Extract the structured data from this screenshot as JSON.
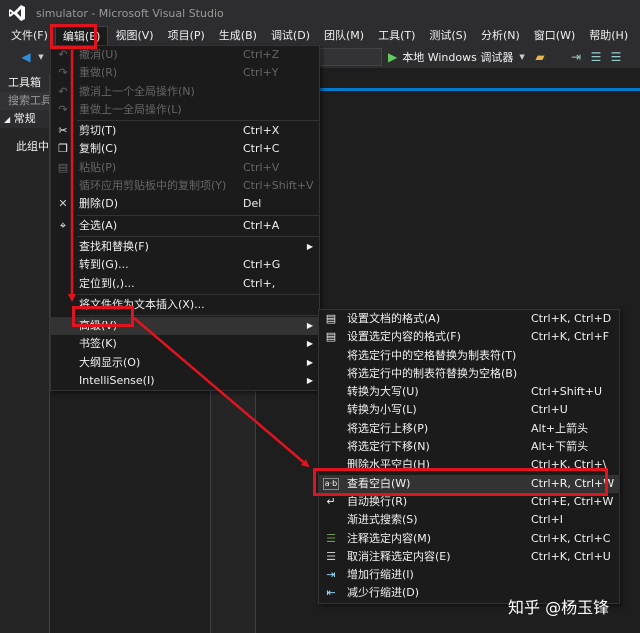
{
  "window": {
    "title": "simulator - Microsoft Visual Studio"
  },
  "menubar": {
    "items": [
      "文件(F)",
      "编辑(E)",
      "视图(V)",
      "项目(P)",
      "生成(B)",
      "调试(D)",
      "团队(M)",
      "工具(T)",
      "测试(S)",
      "分析(N)",
      "窗口(W)",
      "帮助(H)"
    ]
  },
  "toolbar": {
    "run_label": "本地 Windows 调试器"
  },
  "toolbox": {
    "title": "工具箱",
    "search_placeholder": "搜索工具",
    "group": "常规",
    "empty_note": "此组中没有可用的控件"
  },
  "edit_menu": {
    "items": [
      {
        "label": "撤消(U)",
        "shortcut": "Ctrl+Z",
        "disabled": true,
        "icon": "undo-icon"
      },
      {
        "label": "重做(R)",
        "shortcut": "Ctrl+Y",
        "disabled": true,
        "icon": "redo-icon"
      },
      {
        "label": "撤消上一个全局操作(N)",
        "shortcut": "",
        "disabled": true,
        "icon": "undo-global-icon"
      },
      {
        "label": "重做上一全局操作(L)",
        "shortcut": "",
        "disabled": true,
        "icon": "redo-global-icon"
      },
      {
        "sep": true
      },
      {
        "label": "剪切(T)",
        "shortcut": "Ctrl+X",
        "icon": "cut-icon"
      },
      {
        "label": "复制(C)",
        "shortcut": "Ctrl+C",
        "icon": "copy-icon"
      },
      {
        "label": "粘贴(P)",
        "shortcut": "Ctrl+V",
        "disabled": true,
        "icon": "paste-icon"
      },
      {
        "label": "循环应用剪贴板中的复制项(Y)",
        "shortcut": "Ctrl+Shift+V",
        "disabled": true
      },
      {
        "label": "删除(D)",
        "shortcut": "Del",
        "icon": "delete-icon"
      },
      {
        "sep": true
      },
      {
        "label": "全选(A)",
        "shortcut": "Ctrl+A",
        "icon": "select-all-icon"
      },
      {
        "sep": true
      },
      {
        "label": "查找和替换(F)",
        "shortcut": "",
        "submenu": true
      },
      {
        "label": "转到(G)...",
        "shortcut": "Ctrl+G"
      },
      {
        "label": "定位到(,)...",
        "shortcut": "Ctrl+,"
      },
      {
        "sep": true
      },
      {
        "label": "将文件作为文本插入(X)...",
        "shortcut": ""
      },
      {
        "sep": true
      },
      {
        "label": "高级(V)",
        "shortcut": "",
        "submenu": true,
        "highlighted": true
      },
      {
        "label": "书签(K)",
        "shortcut": "",
        "submenu": true
      },
      {
        "label": "大纲显示(O)",
        "shortcut": "",
        "submenu": true
      },
      {
        "label": "IntelliSense(I)",
        "shortcut": "",
        "submenu": true
      }
    ]
  },
  "advanced_menu": {
    "items": [
      {
        "label": "设置文档的格式(A)",
        "shortcut": "Ctrl+K, Ctrl+D",
        "icon": "format-document-icon"
      },
      {
        "label": "设置选定内容的格式(F)",
        "shortcut": "Ctrl+K, Ctrl+F",
        "icon": "format-selection-icon"
      },
      {
        "label": "将选定行中的空格替换为制表符(T)",
        "shortcut": ""
      },
      {
        "label": "将选定行中的制表符替换为空格(B)",
        "shortcut": ""
      },
      {
        "label": "转换为大写(U)",
        "shortcut": "Ctrl+Shift+U"
      },
      {
        "label": "转换为小写(L)",
        "shortcut": "Ctrl+U"
      },
      {
        "label": "将选定行上移(P)",
        "shortcut": "Alt+上箭头"
      },
      {
        "label": "将选定行下移(N)",
        "shortcut": "Alt+下箭头"
      },
      {
        "label": "删除水平空白(H)",
        "shortcut": "Ctrl+K, Ctrl+\\"
      },
      {
        "label": "查看空白(W)",
        "shortcut": "Ctrl+R, Ctrl+W",
        "icon": "view-whitespace-icon",
        "highlighted": true
      },
      {
        "label": "自动换行(R)",
        "shortcut": "Ctrl+E, Ctrl+W",
        "icon": "word-wrap-icon"
      },
      {
        "label": "渐进式搜索(S)",
        "shortcut": "Ctrl+I"
      },
      {
        "label": "注释选定内容(M)",
        "shortcut": "Ctrl+K, Ctrl+C",
        "icon": "comment-icon"
      },
      {
        "label": "取消注释选定内容(E)",
        "shortcut": "Ctrl+K, Ctrl+U",
        "icon": "uncomment-icon"
      },
      {
        "label": "增加行缩进(I)",
        "shortcut": "",
        "icon": "increase-indent-icon"
      },
      {
        "label": "减少行缩进(D)",
        "shortcut": "",
        "icon": "decrease-indent-icon"
      }
    ]
  },
  "watermark": "知乎 @杨玉锋",
  "colors": {
    "accent": "#007acc",
    "annotation": "#e0141e",
    "vs_purple": "#68217a"
  }
}
